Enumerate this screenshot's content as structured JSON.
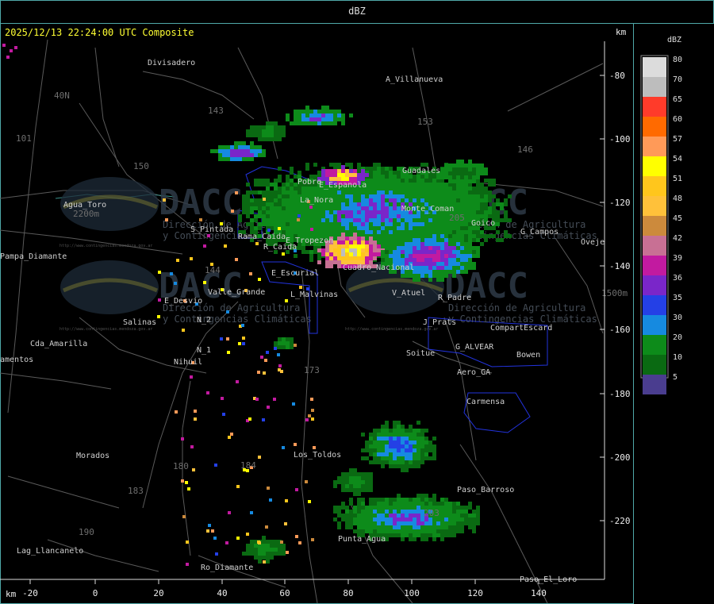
{
  "window": {
    "title": "dBZ"
  },
  "header": {
    "timestamp": "2025/12/13 22:24:00 UTC Composite",
    "km_top": "km",
    "km_bottom": "km"
  },
  "legend": {
    "title": "dBZ",
    "entries": [
      {
        "value": "80",
        "color": "#dcdcdc"
      },
      {
        "value": "70",
        "color": "#bdbdbd"
      },
      {
        "value": "65",
        "color": "#ff3b2a"
      },
      {
        "value": "60",
        "color": "#ff6a00"
      },
      {
        "value": "57",
        "color": "#ff9a58"
      },
      {
        "value": "54",
        "color": "#ffff00"
      },
      {
        "value": "51",
        "color": "#ffc61c"
      },
      {
        "value": "48",
        "color": "#ffc13a"
      },
      {
        "value": "45",
        "color": "#cc8a3c"
      },
      {
        "value": "42",
        "color": "#c87094"
      },
      {
        "value": "39",
        "color": "#c21aa0"
      },
      {
        "value": "36",
        "color": "#7a26c9"
      },
      {
        "value": "35",
        "color": "#2440e6"
      },
      {
        "value": "30",
        "color": "#168ae0"
      },
      {
        "value": "20",
        "color": "#0d8b1a"
      },
      {
        "value": "10",
        "color": "#0a6a12"
      },
      {
        "value": "5",
        "color": "#4a3d8f"
      }
    ]
  },
  "axes": {
    "x_ticks": [
      "-20",
      "0",
      "20",
      "40",
      "60",
      "80",
      "100",
      "120",
      "140"
    ],
    "y_ticks": [
      "-80",
      "-100",
      "-120",
      "-140",
      "-160",
      "-180",
      "-200",
      "-220"
    ]
  },
  "places": [
    {
      "name": "Divisadero"
    },
    {
      "name": "A_Villanueva"
    },
    {
      "name": "Agua_Toro"
    },
    {
      "name": "Pampa_Diamante"
    },
    {
      "name": "Guadales"
    },
    {
      "name": "E_Espanola"
    },
    {
      "name": "La_Nora"
    },
    {
      "name": "Goico"
    },
    {
      "name": "G_Campos"
    },
    {
      "name": "Oveje"
    },
    {
      "name": "S_Pintada"
    },
    {
      "name": "R_Caida"
    },
    {
      "name": "E_Escurial"
    },
    {
      "name": "Valle_Grande"
    },
    {
      "name": "L_Malvinas"
    },
    {
      "name": "V_Atuel"
    },
    {
      "name": "R_Padre"
    },
    {
      "name": "E_Desvio"
    },
    {
      "name": "Salinas"
    },
    {
      "name": "N_2"
    },
    {
      "name": "N_1"
    },
    {
      "name": "Nihuil"
    },
    {
      "name": "Cda_Amarilla"
    },
    {
      "name": "amentos"
    },
    {
      "name": "J_Prats"
    },
    {
      "name": "CompartEscard"
    },
    {
      "name": "G_ALVEAR"
    },
    {
      "name": "Bowen"
    },
    {
      "name": "Soitue"
    },
    {
      "name": "Aero_GA"
    },
    {
      "name": "Carmensa"
    },
    {
      "name": "Los_Toldos"
    },
    {
      "name": "Morados"
    },
    {
      "name": "Paso_Barroso"
    },
    {
      "name": "Punta_Agua"
    },
    {
      "name": "Lag_Llancanelo"
    },
    {
      "name": "Paso_El_Loro"
    },
    {
      "name": "Rama_Caida"
    },
    {
      "name": "Monte_Coman"
    },
    {
      "name": "E_Tropezon"
    },
    {
      "name": "Pobre"
    },
    {
      "name": "Cuadro_Nacional"
    },
    {
      "name": "40N"
    },
    {
      "name": "101"
    },
    {
      "name": "143"
    },
    {
      "name": "153"
    },
    {
      "name": "146"
    },
    {
      "name": "150"
    },
    {
      "name": "144"
    },
    {
      "name": "173"
    },
    {
      "name": "184"
    },
    {
      "name": "180"
    },
    {
      "name": "183"
    },
    {
      "name": "190"
    },
    {
      "name": "203"
    },
    {
      "name": "205"
    },
    {
      "name": "1500m"
    },
    {
      "name": "2200m"
    },
    {
      "name": "Ro_Diamante"
    }
  ],
  "watermark": {
    "brand": "DACC",
    "line1": "Dirección de Agricultura",
    "line2": "y Contingencias Climáticas",
    "url": "http://www.contingencias.mendoza.gov.ar"
  }
}
